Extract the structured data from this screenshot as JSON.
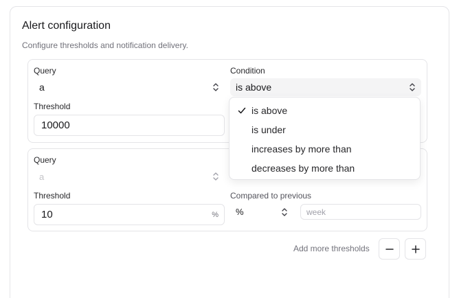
{
  "card": {
    "title": "Alert configuration",
    "description": "Configure thresholds and notification delivery."
  },
  "group1": {
    "query_label": "Query",
    "query_value": "a",
    "condition_label": "Condition",
    "condition_value": "is above",
    "threshold_label": "Threshold",
    "threshold_value": "10000"
  },
  "dropdown": {
    "selected": "is above",
    "options": [
      "is above",
      "is under",
      "increases by more than",
      "decreases by more than"
    ]
  },
  "group2": {
    "query_label": "Query",
    "query_value": "a",
    "threshold_label": "Threshold",
    "threshold_value": "10",
    "threshold_suffix": "%",
    "compared_label": "Compared to previous",
    "unit_value": "%",
    "period_placeholder": "week"
  },
  "footer": {
    "add_label": "Add more thresholds"
  },
  "icons": {
    "chevron": "chevron-up-down-icon",
    "check": "check-icon",
    "minus": "minus-icon",
    "plus": "plus-icon"
  }
}
